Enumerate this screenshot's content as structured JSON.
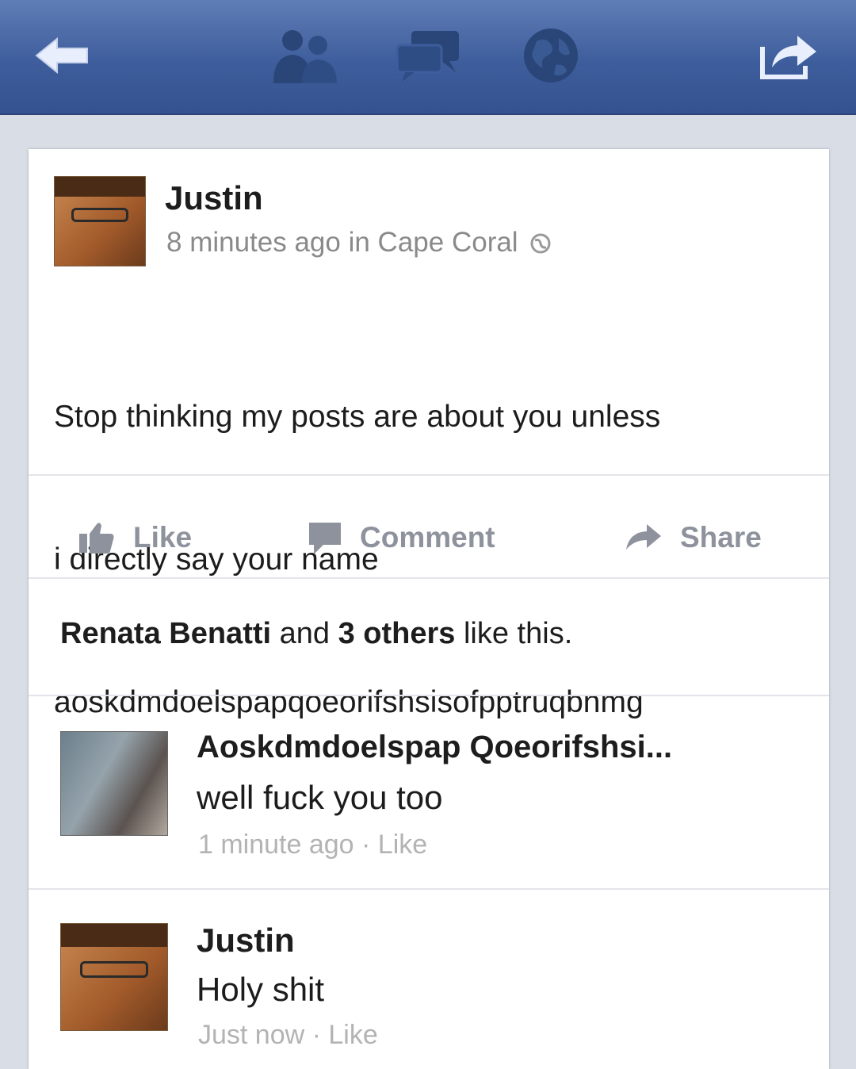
{
  "nav": {
    "icons": [
      "back-arrow-icon",
      "friends-icon",
      "messages-icon",
      "globe-icon",
      "share-out-icon"
    ]
  },
  "post": {
    "author": "Justin",
    "meta": "8 minutes ago in Cape Coral",
    "text_lines": [
      "Stop thinking my posts are about you unless",
      "i directly say your name",
      "aoskdmdoelspapqoeorifshsisofpptruqbnmg"
    ]
  },
  "actions": {
    "like": "Like",
    "comment": "Comment",
    "share": "Share"
  },
  "likes": {
    "name": "Renata Benatti",
    "and": " and ",
    "count": "3 others",
    "suffix": " like this."
  },
  "comments": [
    {
      "author": "Aoskdmdoelspap Qoeorifshsi...",
      "text": "well fuck you too",
      "meta": "1 minute ago · Like"
    },
    {
      "author": "Justin",
      "text": "Holy shit",
      "meta": "Just now · Like"
    }
  ],
  "colors": {
    "navbar": "#3e5d9c",
    "background": "#d9dde6",
    "action_gray": "#8d929c"
  }
}
